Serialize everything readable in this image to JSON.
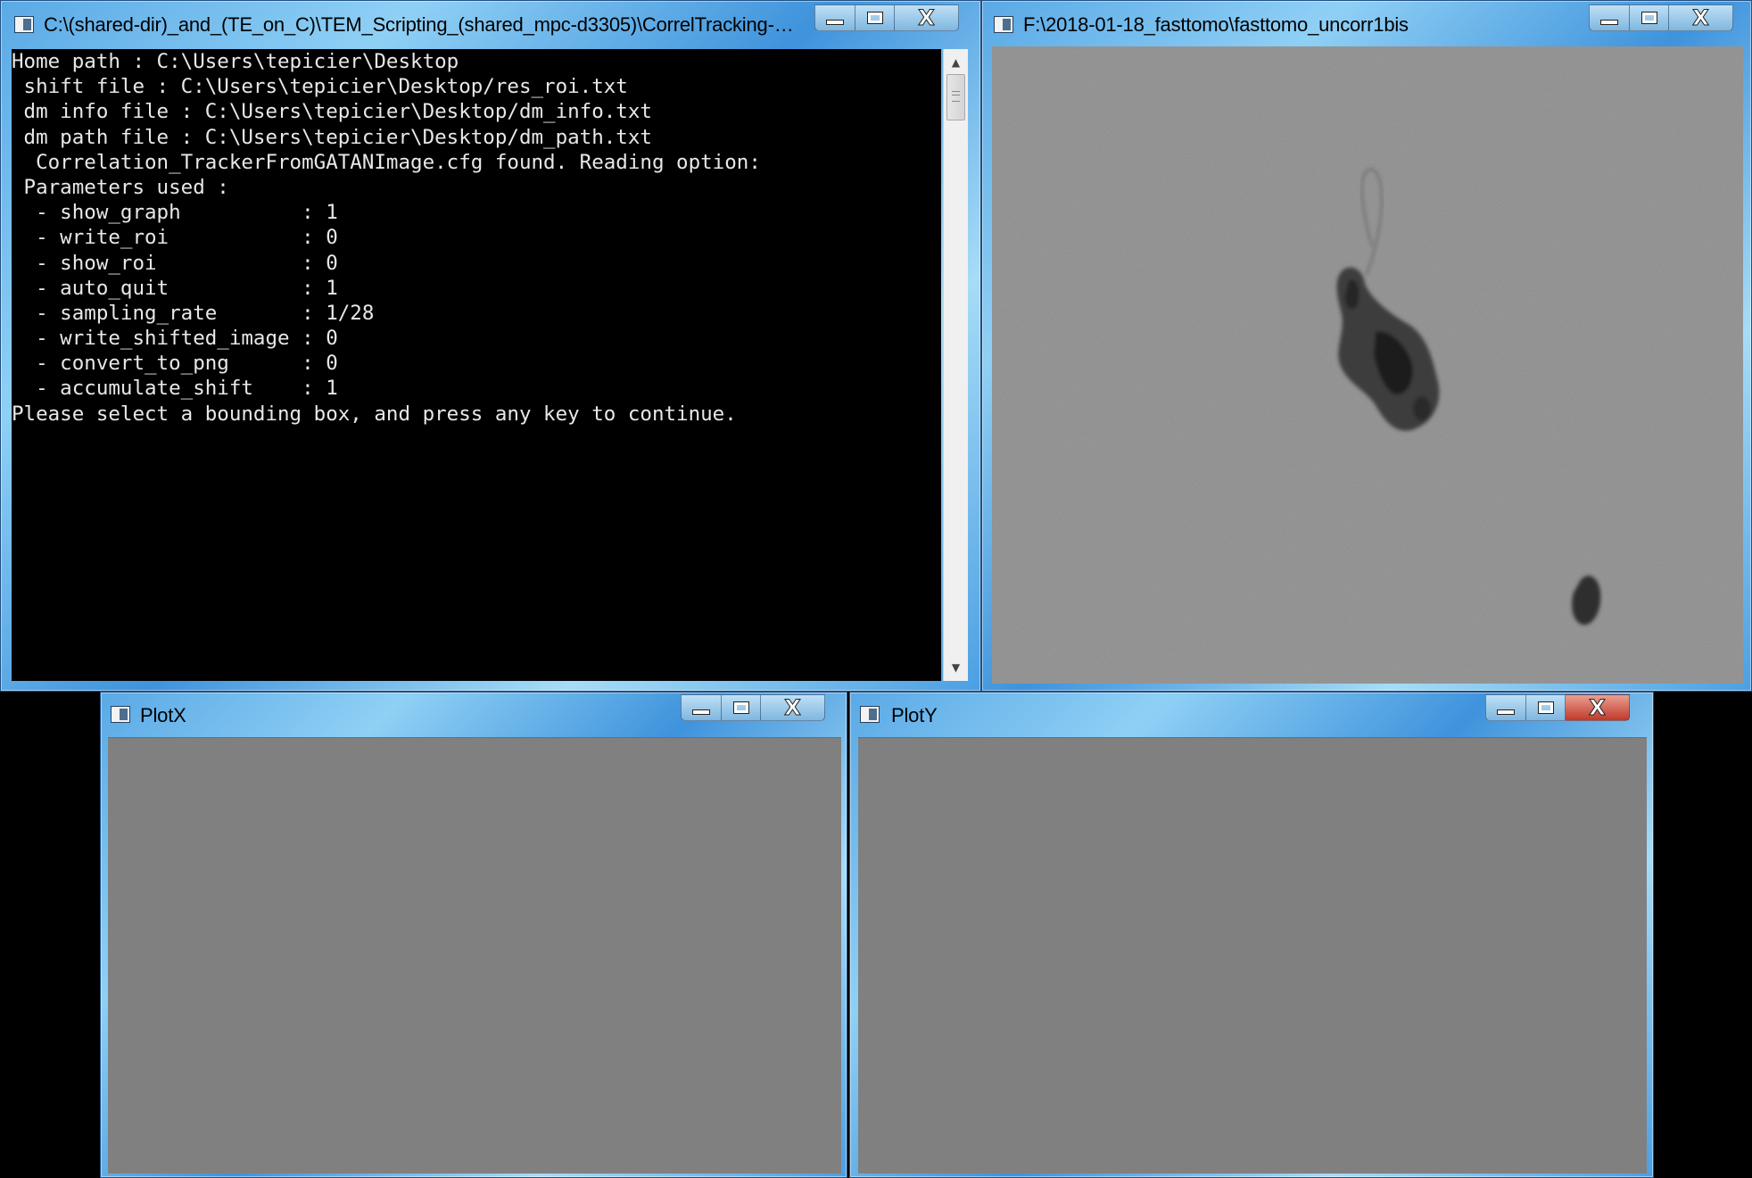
{
  "console_window": {
    "title": "C:\\(shared-dir)_and_(TE_on_C)\\TEM_Scripting_(shared_mpc-d3305)\\CorrelTracking-Release...",
    "lines": [
      "Home path : C:\\Users\\tepicier\\Desktop",
      " shift file : C:\\Users\\tepicier\\Desktop/res_roi.txt",
      " dm info file : C:\\Users\\tepicier\\Desktop/dm_info.txt",
      " dm path file : C:\\Users\\tepicier\\Desktop/dm_path.txt",
      "  Correlation_TrackerFromGATANImage.cfg found. Reading option:",
      " Parameters used :",
      "  - show_graph          : 1",
      "  - write_roi           : 0",
      "  - show_roi            : 0",
      "  - auto_quit           : 1",
      "  - sampling_rate       : 1/28",
      "  - write_shifted_image : 0",
      "  - convert_to_png      : 0",
      "  - accumulate_shift    : 1",
      "Please select a bounding box, and press any key to continue."
    ]
  },
  "image_window": {
    "title": "F:\\2018-01-18_fasttomo\\fasttomo_uncorr1bis"
  },
  "plotx_window": {
    "title": "PlotX"
  },
  "ploty_window": {
    "title": "PlotY"
  },
  "icons": {
    "minimize": "minimize-icon",
    "maximize": "maximize-icon",
    "close": "close-icon",
    "app": "app-window-icon"
  },
  "colors": {
    "console_bg": "#000000",
    "console_text": "#e8e8e8",
    "plot_bg": "#808080",
    "titlebar": "#5aa9e6"
  }
}
